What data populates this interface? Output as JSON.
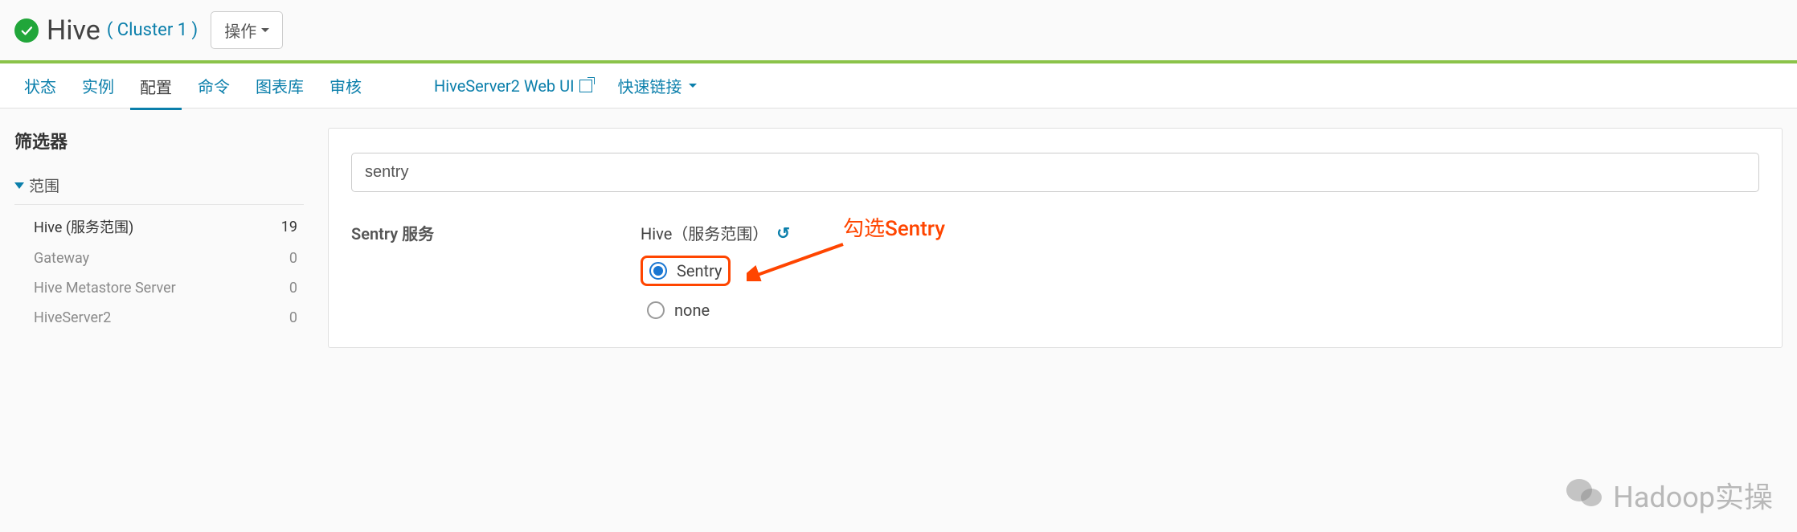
{
  "header": {
    "service_name": "Hive",
    "cluster_name": "( Cluster 1 )",
    "actions_label": "操作"
  },
  "tabs": {
    "items": [
      "状态",
      "实例",
      "配置",
      "命令",
      "图表库",
      "审核"
    ],
    "active_index": 2,
    "external_link": "HiveServer2 Web UI",
    "quick_links": "快速链接"
  },
  "sidebar": {
    "filter_title": "筛选器",
    "section_title": "范围",
    "items": [
      {
        "label": "Hive (服务范围)",
        "count": "19",
        "active": true
      },
      {
        "label": "Gateway",
        "count": "0",
        "active": false
      },
      {
        "label": "Hive Metastore Server",
        "count": "0",
        "active": false
      },
      {
        "label": "HiveServer2",
        "count": "0",
        "active": false
      }
    ]
  },
  "config": {
    "search_value": "sentry",
    "property_label": "Sentry 服务",
    "scope_label": "Hive（服务范围）",
    "options": [
      {
        "label": "Sentry",
        "checked": true
      },
      {
        "label": "none",
        "checked": false
      }
    ]
  },
  "annotation": "勾选Sentry",
  "watermark": "Hadoop实操"
}
